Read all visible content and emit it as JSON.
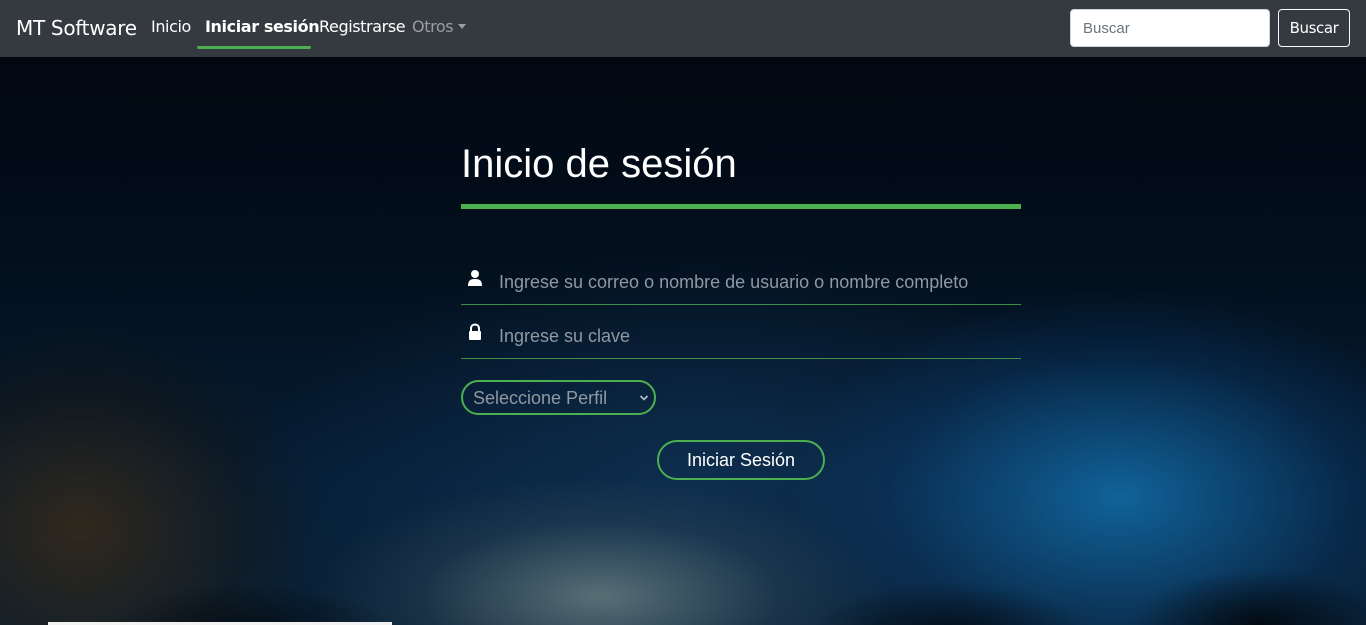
{
  "navbar": {
    "brand": "MT Software",
    "links": [
      {
        "label": "Inicio"
      },
      {
        "label": "Iniciar sesión",
        "active": true
      },
      {
        "label": "Registrarse"
      },
      {
        "label": "Otros",
        "dropdown": true
      }
    ],
    "search": {
      "placeholder": "Buscar",
      "button_label": "Buscar"
    }
  },
  "login": {
    "title": "Inicio de sesión",
    "user_field": {
      "placeholder": "Ingrese su correo o nombre de usuario o nombre completo",
      "icon": "user-icon"
    },
    "password_field": {
      "placeholder": "Ingrese su clave",
      "icon": "lock-icon"
    },
    "profile_select": {
      "selected": "Seleccione Perfil",
      "icon": "chevron-down-icon"
    },
    "submit_label": "Iniciar Sesión"
  },
  "colors": {
    "navbar_bg": "#343a40",
    "accent_green": "#4caf50",
    "text_white": "#ffffff",
    "placeholder_gray": "#8f98a3"
  }
}
